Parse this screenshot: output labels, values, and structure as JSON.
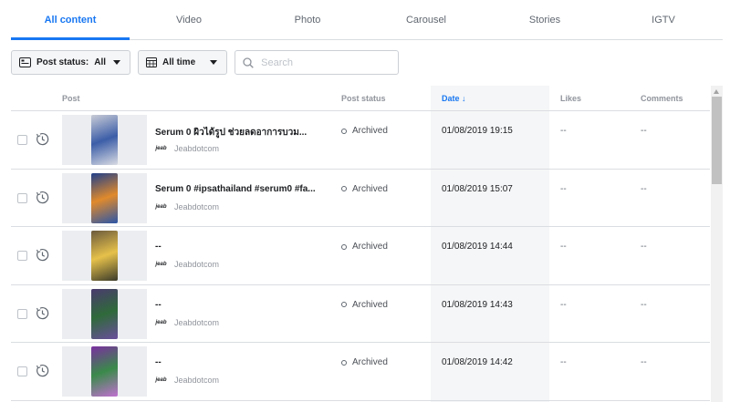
{
  "tabs": [
    {
      "label": "All content",
      "active": true
    },
    {
      "label": "Video",
      "active": false
    },
    {
      "label": "Photo",
      "active": false
    },
    {
      "label": "Carousel",
      "active": false
    },
    {
      "label": "Stories",
      "active": false
    },
    {
      "label": "IGTV",
      "active": false
    }
  ],
  "toolbar": {
    "post_status_label": "Post status:",
    "post_status_value": "All",
    "time_filter": "All time",
    "search_placeholder": "Search"
  },
  "table": {
    "columns": {
      "post": "Post",
      "status": "Post status",
      "date": "Date ↓",
      "likes": "Likes",
      "comments": "Comments"
    },
    "rows": [
      {
        "title": "Serum 0 ผิวได้รูป ช่วยลดอาการบวม...",
        "account": "Jeabdotcom",
        "status": "Archived",
        "date": "01/08/2019 19:15",
        "likes": "--",
        "comments": "--"
      },
      {
        "title": "Serum 0 #ipsathailand #serum0 #fa...",
        "account": "Jeabdotcom",
        "status": "Archived",
        "date": "01/08/2019 15:07",
        "likes": "--",
        "comments": "--"
      },
      {
        "title": "--",
        "account": "Jeabdotcom",
        "status": "Archived",
        "date": "01/08/2019 14:44",
        "likes": "--",
        "comments": "--"
      },
      {
        "title": "--",
        "account": "Jeabdotcom",
        "status": "Archived",
        "date": "01/08/2019 14:43",
        "likes": "--",
        "comments": "--"
      },
      {
        "title": "--",
        "account": "Jeabdotcom",
        "status": "Archived",
        "date": "01/08/2019 14:42",
        "likes": "--",
        "comments": "--"
      }
    ]
  },
  "account_logo_text": "jeab",
  "colors": {
    "accent": "#1877f2",
    "thumbs": [
      [
        "#c9ccd6",
        "#3c5ea8",
        "#d9dbe3"
      ],
      [
        "#1f3f8a",
        "#e08a2c",
        "#2a55a8"
      ],
      [
        "#6b5a3d",
        "#e6c14a",
        "#3a3a2a"
      ],
      [
        "#4a3a6e",
        "#2f6a3a",
        "#6a4e9c"
      ],
      [
        "#7a2fa0",
        "#3a8a4a",
        "#c070d0"
      ]
    ]
  }
}
